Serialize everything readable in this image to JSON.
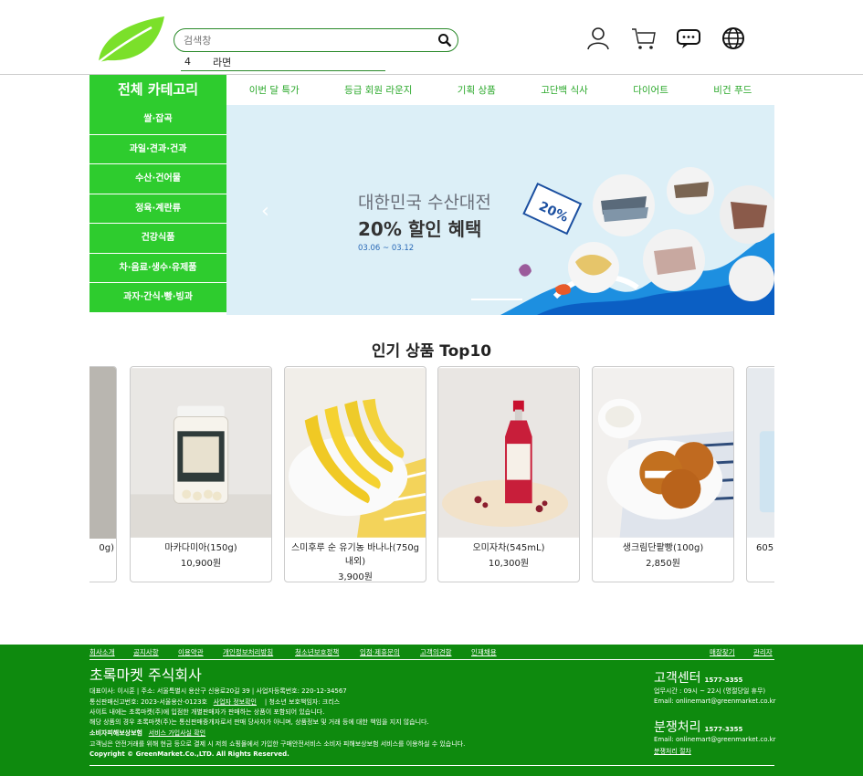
{
  "header": {
    "search_placeholder": "검색창",
    "suggest_rank": "4",
    "suggest_term": "라면"
  },
  "nav": {
    "all_category": "전체 카테고리",
    "gnb": [
      "이번 달 특가",
      "등급 회원 라운지",
      "기획 상품",
      "고단백 식사",
      "다이어트",
      "비건 푸드"
    ]
  },
  "sidebar": [
    "쌀·잡곡",
    "과일·견과·건과",
    "수산·건어물",
    "정육·계란류",
    "건강식품",
    "차·음료·생수·유제품",
    "과자·간식·빵·빙과"
  ],
  "banner": {
    "title1": "대한민국 수산대전",
    "title2": "20% 할인 혜택",
    "date": "03.06 ~ 03.12",
    "badge": "20%",
    "prev": "‹"
  },
  "popular": {
    "title": "인기 상품 Top10",
    "partial_left_name": "0g)",
    "partial_right_name": "605",
    "items": [
      {
        "name": "마카다미아(150g)",
        "price": "10,900원"
      },
      {
        "name": "스미후루 순 유기농 바나나(750g 내외)",
        "price": "3,900원"
      },
      {
        "name": "오미자차(545mL)",
        "price": "10,300원"
      },
      {
        "name": "생크림단팥빵(100g)",
        "price": "2,850원"
      }
    ]
  },
  "footer": {
    "links_left": [
      "회사소개",
      "공지사항",
      "이용약관",
      "개인정보처리방침",
      "청소년보호정책",
      "입점·제휴문의",
      "고객의견함",
      "인재채용"
    ],
    "links_right": [
      "매장찾기",
      "관리자"
    ],
    "company": "초록마켓 주식회사",
    "line1": "대표이사: 이시훈    |    주소: 서울특별시 용산구 신용로20길 39    |    사업자등록번호: 220-12-34567",
    "line2a": "통신판매신고번호: 2023-서울용산-0123호",
    "line2b": "사업자 정보확인",
    "line2c": "|    청소년 보호책임자: 크리스",
    "line3": "사이트 내에는 초록마켓(주)에 입점한 개별판매자가 판매하는 상품이 포함되어 있습니다.",
    "line4": "해당 상품의 경우 초록마켓(주)는 통신판매중개자로서 판매 당사자가 아니며, 상품정보 및 거래 등에 대한 책임을 지지 않습니다.",
    "line5a": "소비자피해보상보험",
    "line5b": "서비스 가입사실 확인",
    "line6": "고객님은 안전거래를 위해 현금 등으로 결제 시 저희 쇼핑몰에서 가입한 구매안전서비스 소비자 피해보상보험 서비스를 이용하실 수 있습니다.",
    "copyright": "Copyright © GreenMarket.Co.,LTD. All Rights Reserved.",
    "cs_title": "고객센터",
    "cs_phone": "1577-3355",
    "cs_hours": "업무시간 : 09시 ~ 22시 (명절당일 휴무)",
    "cs_email": "Email: onlinemart@greenmarket.co.kr",
    "dispute_title": "분쟁처리",
    "dispute_phone": "1577-3355",
    "dispute_email": "Email: onlinemart@greenmarket.co.kr",
    "dispute_link": "분쟁처리 절차"
  },
  "colors": {
    "brand_green": "#2ecc2e",
    "footer_green": "#0e8a0e",
    "nav_text": "#2aa82a"
  }
}
